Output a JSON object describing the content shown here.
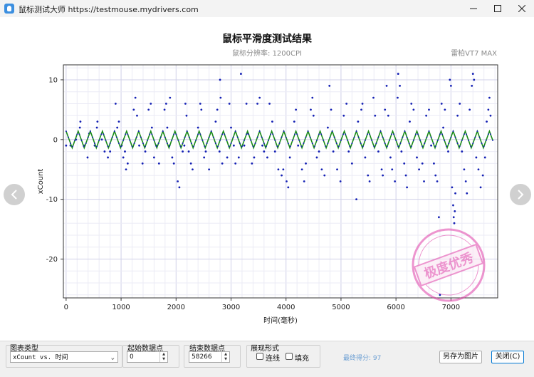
{
  "window": {
    "title": "鼠标测试大师 https://testmouse.mydrivers.com"
  },
  "chart_header": {
    "title": "鼠标平滑度测试结果",
    "subtitle": "鼠标分辨率:  1200CPI",
    "device": "雷柏VT7 MAX"
  },
  "stamp": {
    "text": "极度优秀"
  },
  "chart_data": {
    "type": "scatter",
    "title": "鼠标平滑度测试结果",
    "xlabel": "时间(毫秒)",
    "ylabel": "xCount",
    "xlim": [
      -50,
      7850
    ],
    "ylim": [
      -26.5,
      12.5
    ],
    "x_ticks": [
      "0",
      "1000",
      "2000",
      "3000",
      "4000",
      "5000",
      "6000",
      "7000"
    ],
    "y_ticks": [
      "10",
      "0",
      "-10",
      "-20"
    ],
    "grid": true,
    "series": [
      {
        "name": "",
        "kind": "points",
        "color": "#1420b4",
        "points": [
          [
            0,
            -1
          ],
          [
            80,
            -1
          ],
          [
            180,
            0
          ],
          [
            250,
            2
          ],
          [
            260,
            3
          ],
          [
            330,
            -1
          ],
          [
            390,
            -3
          ],
          [
            420,
            1
          ],
          [
            520,
            -1
          ],
          [
            560,
            2
          ],
          [
            570,
            3
          ],
          [
            650,
            0
          ],
          [
            700,
            -2
          ],
          [
            760,
            -3
          ],
          [
            800,
            -2
          ],
          [
            900,
            6
          ],
          [
            930,
            2
          ],
          [
            960,
            3
          ],
          [
            1010,
            -1
          ],
          [
            1040,
            -3
          ],
          [
            1070,
            -2
          ],
          [
            1090,
            -5
          ],
          [
            1120,
            -4
          ],
          [
            1230,
            5
          ],
          [
            1260,
            7
          ],
          [
            1290,
            4
          ],
          [
            1330,
            -1
          ],
          [
            1390,
            -4
          ],
          [
            1440,
            -2
          ],
          [
            1500,
            5
          ],
          [
            1540,
            6
          ],
          [
            1560,
            2
          ],
          [
            1600,
            -3
          ],
          [
            1640,
            -1
          ],
          [
            1690,
            -4
          ],
          [
            1790,
            5
          ],
          [
            1820,
            6
          ],
          [
            1840,
            2
          ],
          [
            1880,
            -1
          ],
          [
            1890,
            7
          ],
          [
            1930,
            -3
          ],
          [
            1960,
            -4
          ],
          [
            2030,
            -7
          ],
          [
            2060,
            -8
          ],
          [
            2120,
            -2
          ],
          [
            2150,
            -1
          ],
          [
            2170,
            6
          ],
          [
            2190,
            4
          ],
          [
            2230,
            -2
          ],
          [
            2270,
            -4
          ],
          [
            2300,
            -5
          ],
          [
            2400,
            2
          ],
          [
            2440,
            6
          ],
          [
            2460,
            5
          ],
          [
            2510,
            -3
          ],
          [
            2540,
            -2
          ],
          [
            2600,
            -5
          ],
          [
            2720,
            3
          ],
          [
            2750,
            5
          ],
          [
            2790,
            -2
          ],
          [
            2800,
            10
          ],
          [
            2810,
            7
          ],
          [
            2840,
            -4
          ],
          [
            2930,
            -3
          ],
          [
            2970,
            6
          ],
          [
            3000,
            2
          ],
          [
            3050,
            -1
          ],
          [
            3080,
            -4
          ],
          [
            3140,
            -3
          ],
          [
            3180,
            11
          ],
          [
            3240,
            -1
          ],
          [
            3280,
            6
          ],
          [
            3310,
            1
          ],
          [
            3380,
            -4
          ],
          [
            3420,
            -3
          ],
          [
            3480,
            6
          ],
          [
            3520,
            7
          ],
          [
            3570,
            -1
          ],
          [
            3600,
            -2
          ],
          [
            3660,
            -3
          ],
          [
            3700,
            6
          ],
          [
            3750,
            3
          ],
          [
            3800,
            -2
          ],
          [
            3860,
            -5
          ],
          [
            3920,
            -6
          ],
          [
            3950,
            -5
          ],
          [
            4010,
            -7
          ],
          [
            4040,
            -8
          ],
          [
            4070,
            -3
          ],
          [
            4150,
            3
          ],
          [
            4180,
            5
          ],
          [
            4220,
            -1
          ],
          [
            4290,
            -5
          ],
          [
            4330,
            -7
          ],
          [
            4360,
            -4
          ],
          [
            4450,
            5
          ],
          [
            4480,
            7
          ],
          [
            4500,
            4
          ],
          [
            4560,
            -3
          ],
          [
            4600,
            -2
          ],
          [
            4650,
            -5
          ],
          [
            4700,
            -6
          ],
          [
            4760,
            2
          ],
          [
            4790,
            9
          ],
          [
            4820,
            5
          ],
          [
            4860,
            -2
          ],
          [
            4930,
            -5
          ],
          [
            4990,
            -7
          ],
          [
            5050,
            4
          ],
          [
            5100,
            6
          ],
          [
            5140,
            -2
          ],
          [
            5200,
            -4
          ],
          [
            5280,
            -10
          ],
          [
            5310,
            3
          ],
          [
            5370,
            5
          ],
          [
            5390,
            6
          ],
          [
            5440,
            -3
          ],
          [
            5490,
            -6
          ],
          [
            5520,
            -7
          ],
          [
            5590,
            7
          ],
          [
            5620,
            4
          ],
          [
            5680,
            -2
          ],
          [
            5740,
            -5
          ],
          [
            5760,
            -6
          ],
          [
            5800,
            5
          ],
          [
            5830,
            9
          ],
          [
            5860,
            4
          ],
          [
            5900,
            -3
          ],
          [
            5930,
            -5
          ],
          [
            5980,
            -7
          ],
          [
            6030,
            7
          ],
          [
            6040,
            11
          ],
          [
            6070,
            9
          ],
          [
            6100,
            -2
          ],
          [
            6150,
            -4
          ],
          [
            6180,
            -6
          ],
          [
            6200,
            -8
          ],
          [
            6250,
            3
          ],
          [
            6280,
            6
          ],
          [
            6320,
            5
          ],
          [
            6380,
            -3
          ],
          [
            6420,
            -5
          ],
          [
            6480,
            -4
          ],
          [
            6510,
            -7
          ],
          [
            6550,
            4
          ],
          [
            6600,
            5
          ],
          [
            6640,
            -1
          ],
          [
            6690,
            -4
          ],
          [
            6720,
            -6
          ],
          [
            6750,
            -7
          ],
          [
            6780,
            -13
          ],
          [
            6800,
            -26
          ],
          [
            6830,
            6
          ],
          [
            6860,
            2
          ],
          [
            6890,
            5
          ],
          [
            6950,
            -2
          ],
          [
            6980,
            10
          ],
          [
            7000,
            9
          ],
          [
            7020,
            -8
          ],
          [
            7040,
            -11
          ],
          [
            7050,
            -13
          ],
          [
            7060,
            -14
          ],
          [
            7070,
            -12
          ],
          [
            7080,
            -9
          ],
          [
            7120,
            4
          ],
          [
            7160,
            6
          ],
          [
            7200,
            -2
          ],
          [
            7240,
            -5
          ],
          [
            7270,
            -7
          ],
          [
            7290,
            -9
          ],
          [
            7340,
            5
          ],
          [
            7380,
            9
          ],
          [
            7400,
            11
          ],
          [
            7420,
            10
          ],
          [
            7460,
            -3
          ],
          [
            7500,
            -5
          ],
          [
            7540,
            -8
          ],
          [
            7580,
            -6
          ],
          [
            7620,
            -3
          ],
          [
            7650,
            3
          ],
          [
            7680,
            5
          ],
          [
            7700,
            7
          ],
          [
            7720,
            4
          ]
        ]
      },
      {
        "name": "",
        "kind": "line",
        "color": "#1a8a1a",
        "period_ms": 220,
        "amplitude": 1.4
      }
    ]
  },
  "nav": {
    "prev_icon": "chevron-left-icon",
    "next_icon": "chevron-right-icon"
  },
  "controls": {
    "chart_type_label": "图表类型",
    "chart_type_value": "xCount vs. 时间",
    "start_label": "起始数据点",
    "start_value": "0",
    "end_label": "结束数据点",
    "end_value": "58266",
    "display_label": "展现形式",
    "line_label": "连线",
    "fill_label": "填充",
    "score_text": "最终得分: 97",
    "save_image_label": "另存为图片",
    "close_label": "关闭(C)"
  }
}
